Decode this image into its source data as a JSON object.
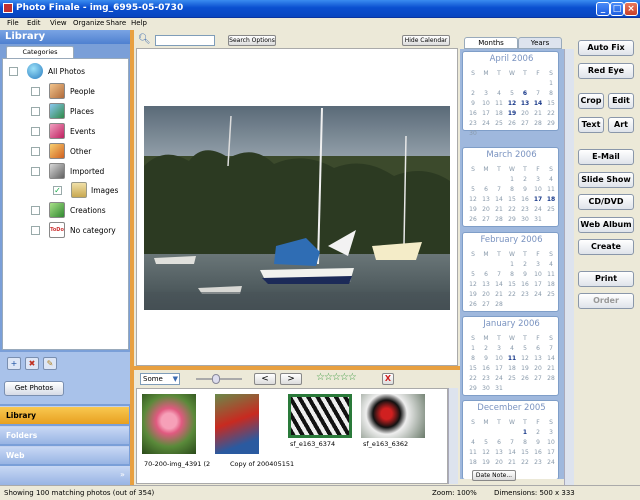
{
  "window": {
    "title": "Photo Finale - img_6995-05-0730"
  },
  "menu": [
    "File",
    "Edit",
    "View",
    "Organize",
    "Share",
    "Help"
  ],
  "library": {
    "header": "Library",
    "tab": "Categories",
    "items": [
      {
        "label": "All Photos",
        "icon": "globe-icon"
      },
      {
        "label": "People",
        "icon": "people-icon"
      },
      {
        "label": "Places",
        "icon": "places-icon"
      },
      {
        "label": "Events",
        "icon": "events-icon"
      },
      {
        "label": "Other",
        "icon": "other-icon"
      },
      {
        "label": "Imported",
        "icon": "imported-icon"
      },
      {
        "label": "Images",
        "icon": "folder-icon"
      },
      {
        "label": "Creations",
        "icon": "creations-icon"
      },
      {
        "label": "No category",
        "icon": "todo-icon"
      }
    ],
    "get_photos": "Get Photos",
    "nav": [
      "Library",
      "Folders",
      "Web"
    ]
  },
  "toolbar": {
    "search_options": "Search Options",
    "hide_calendar": "Hide Calendar"
  },
  "thumbbar": {
    "filter": "Some",
    "prev": "<",
    "next": ">",
    "delete": "X",
    "rating": 0
  },
  "thumbnails": [
    {
      "caption": "70-200-img_4391 (2"
    },
    {
      "caption": "Copy of 200405151"
    },
    {
      "caption": "sf_e163_6374"
    },
    {
      "caption": "sf_e163_6362"
    }
  ],
  "calendar": {
    "tabs": [
      "Months",
      "Years"
    ],
    "weekdays": [
      "S",
      "M",
      "T",
      "W",
      "T",
      "F",
      "S"
    ],
    "months": [
      {
        "title": "April 2006",
        "days": [
          "",
          "",
          "",
          "",
          "",
          "",
          "1",
          "2",
          "3",
          "4",
          "5",
          "6",
          "7",
          "8",
          "9",
          "10",
          "11",
          "12",
          "13",
          "14",
          "15",
          "16",
          "17",
          "18",
          "19",
          "20",
          "21",
          "22",
          "23",
          "24",
          "25",
          "26",
          "27",
          "28",
          "29",
          "30"
        ],
        "bold": [
          "6",
          "12",
          "13",
          "14",
          "19"
        ]
      },
      {
        "title": "March 2006",
        "days": [
          "",
          "",
          "",
          "1",
          "2",
          "3",
          "4",
          "5",
          "6",
          "7",
          "8",
          "9",
          "10",
          "11",
          "12",
          "13",
          "14",
          "15",
          "16",
          "17",
          "18",
          "19",
          "20",
          "21",
          "22",
          "23",
          "24",
          "25",
          "26",
          "27",
          "28",
          "29",
          "30",
          "31"
        ],
        "bold": [
          "17",
          "18"
        ]
      },
      {
        "title": "February 2006",
        "days": [
          "",
          "",
          "",
          "1",
          "2",
          "3",
          "4",
          "5",
          "6",
          "7",
          "8",
          "9",
          "10",
          "11",
          "12",
          "13",
          "14",
          "15",
          "16",
          "17",
          "18",
          "19",
          "20",
          "21",
          "22",
          "23",
          "24",
          "25",
          "26",
          "27",
          "28"
        ],
        "bold": []
      },
      {
        "title": "January 2006",
        "days": [
          "1",
          "2",
          "3",
          "4",
          "5",
          "6",
          "7",
          "8",
          "9",
          "10",
          "11",
          "12",
          "13",
          "14",
          "15",
          "16",
          "17",
          "18",
          "19",
          "20",
          "21",
          "22",
          "23",
          "24",
          "25",
          "26",
          "27",
          "28",
          "29",
          "30",
          "31"
        ],
        "bold": [
          "11"
        ]
      },
      {
        "title": "December 2005",
        "days": [
          "",
          "",
          "",
          "",
          "1",
          "2",
          "3",
          "4",
          "5",
          "6",
          "7",
          "8",
          "9",
          "10",
          "11",
          "12",
          "13",
          "14",
          "15",
          "16",
          "17",
          "18",
          "19",
          "20",
          "21",
          "22",
          "23",
          "24"
        ],
        "bold": [
          "1"
        ]
      }
    ],
    "date_note": "Date Note..."
  },
  "actions": [
    "Auto Fix",
    "Red Eye",
    "Crop",
    "Edit",
    "Text",
    "Art",
    "E-Mail",
    "Slide Show",
    "CD/DVD",
    "Web Album",
    "Create",
    "Print",
    "Order"
  ],
  "status": {
    "left": "Showing 100 matching photos (out of 354)",
    "zoom": "Zoom: 100%",
    "dimensions": "Dimensions: 500 x 333"
  }
}
